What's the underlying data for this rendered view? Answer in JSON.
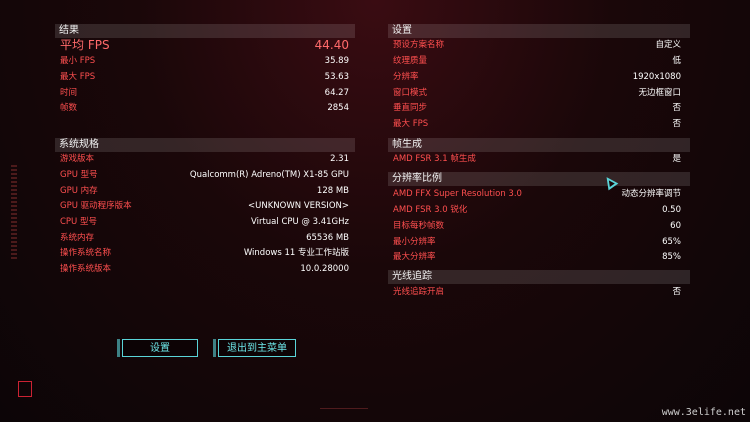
{
  "results": {
    "header": "结果",
    "rows": [
      {
        "label": "平均 FPS",
        "value": "44.40"
      },
      {
        "label": "最小 FPS",
        "value": "35.89"
      },
      {
        "label": "最大 FPS",
        "value": "53.63"
      },
      {
        "label": "时间",
        "value": "64.27"
      },
      {
        "label": "帧数",
        "value": "2854"
      }
    ]
  },
  "system": {
    "header": "系统规格",
    "rows": [
      {
        "label": "游戏版本",
        "value": "2.31"
      },
      {
        "label": "GPU 型号",
        "value": "Qualcomm(R) Adreno(TM) X1-85 GPU"
      },
      {
        "label": "GPU 内存",
        "value": "128 MB"
      },
      {
        "label": "GPU 驱动程序版本",
        "value": "<UNKNOWN VERSION>"
      },
      {
        "label": "CPU 型号",
        "value": "Virtual CPU @ 3.41GHz"
      },
      {
        "label": "系统内存",
        "value": "65536 MB"
      },
      {
        "label": "操作系统名称",
        "value": "Windows 11 专业工作站版"
      },
      {
        "label": "操作系统版本",
        "value": "10.0.28000"
      }
    ]
  },
  "settings": {
    "header": "设置",
    "rows": [
      {
        "label": "预设方案名称",
        "value": "自定义"
      },
      {
        "label": "纹理质量",
        "value": "低"
      },
      {
        "label": "分辨率",
        "value": "1920x1080"
      },
      {
        "label": "窗口模式",
        "value": "无边框窗口"
      },
      {
        "label": "垂直同步",
        "value": "否"
      },
      {
        "label": "最大 FPS",
        "value": "否"
      }
    ]
  },
  "framegen": {
    "header": "帧生成",
    "rows": [
      {
        "label": "AMD FSR 3.1 帧生成",
        "value": "是"
      }
    ]
  },
  "scaling": {
    "header": "分辨率比例",
    "rows": [
      {
        "label": "AMD FFX Super Resolution 3.0",
        "value": "动态分辨率调节"
      },
      {
        "label": "AMD FSR 3.0 锐化",
        "value": "0.50"
      },
      {
        "label": "目标每秒帧数",
        "value": "60"
      },
      {
        "label": "最小分辨率",
        "value": "65%"
      },
      {
        "label": "最大分辨率",
        "value": "85%"
      }
    ]
  },
  "raytracing": {
    "header": "光线追踪",
    "rows": [
      {
        "label": "光线追踪开启",
        "value": "否"
      }
    ]
  },
  "buttons": {
    "settings": "设置",
    "exit": "退出到主菜单"
  },
  "watermark": "www.3elife.net",
  "colors": {
    "accent": "#ff4f4f",
    "button": "#5ad4d8",
    "value": "#ffffff"
  }
}
